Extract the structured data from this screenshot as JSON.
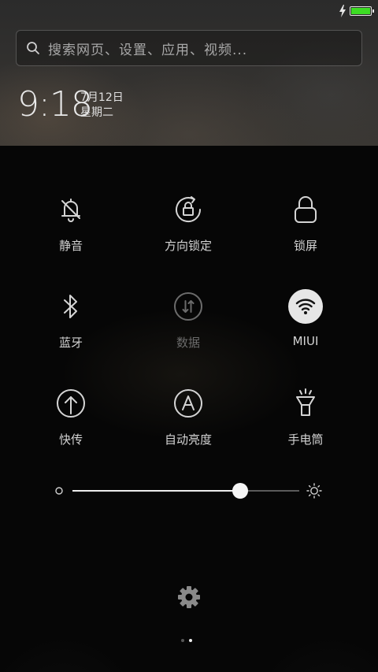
{
  "status": {
    "charging_icon": "lightning-icon",
    "battery_level": 1.0,
    "battery_color": "#3ddc24"
  },
  "search": {
    "placeholder": "搜索网页、设置、应用、视频..."
  },
  "clock": {
    "time": "9:18",
    "date": "7月12日",
    "weekday": "星期二"
  },
  "toggles": [
    {
      "label": "静音",
      "icon": "bell-off-icon",
      "active": false
    },
    {
      "label": "方向锁定",
      "icon": "rotation-lock-icon",
      "active": false
    },
    {
      "label": "锁屏",
      "icon": "lock-icon",
      "active": false
    },
    {
      "label": "蓝牙",
      "icon": "bluetooth-icon",
      "active": false
    },
    {
      "label": "数据",
      "icon": "mobile-data-icon",
      "active": false,
      "disabled": true
    },
    {
      "label": "MIUI",
      "icon": "wifi-icon",
      "active": true
    },
    {
      "label": "快传",
      "icon": "quick-transfer-icon",
      "active": false
    },
    {
      "label": "自动亮度",
      "icon": "auto-brightness-icon",
      "active": false
    },
    {
      "label": "手电筒",
      "icon": "flashlight-icon",
      "active": false
    }
  ],
  "brightness": {
    "level": 0.74,
    "low_icon": "brightness-low-icon",
    "high_icon": "brightness-high-icon"
  },
  "settings": {
    "icon": "gear-icon"
  },
  "pager": {
    "count": 2,
    "current": 1
  }
}
